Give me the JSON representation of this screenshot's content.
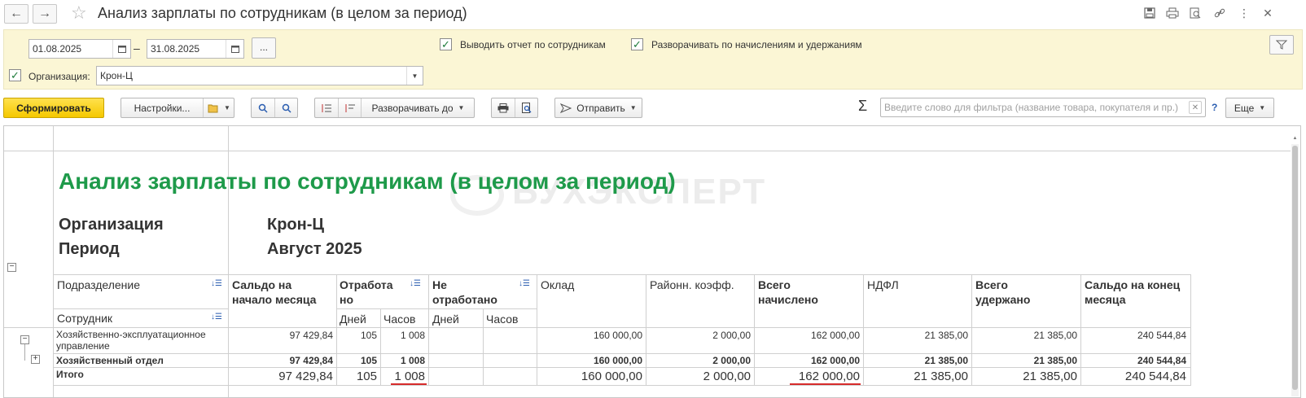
{
  "window": {
    "title": "Анализ зарплаты по сотрудникам (в целом за период)",
    "back_icon": "←",
    "forward_icon": "→",
    "star_icon": "☆",
    "more_icon": "⋮",
    "close_icon": "✕"
  },
  "params": {
    "date_from": "01.08.2025",
    "date_to": "31.08.2025",
    "date_dash": "–",
    "dots_label": "...",
    "show_by_employees_label": "Выводить отчет по сотрудникам",
    "expand_label": "Разворачивать по начислениям и удержаниям",
    "org_label": "Организация:",
    "org_value": "Крон-Ц",
    "check_mark": "✓"
  },
  "toolbar": {
    "generate_label": "Сформировать",
    "settings_label": "Настройки...",
    "expand_to_label": "Разворачивать до",
    "send_label": "Отправить",
    "sigma": "Σ",
    "search_placeholder": "Введите слово для фильтра (название товара, покупателя и пр.)",
    "help_label": "?",
    "more_label": "Еще"
  },
  "report": {
    "title": "Анализ зарплаты по сотрудникам (в целом за период)",
    "watermark": "БУХЭКСПЕРТ",
    "org_label": "Организация",
    "org_value": "Крон-Ц",
    "period_label": "Период",
    "period_value": "Август 2025",
    "headers": {
      "department": "Подразделение",
      "employee": "Сотрудник",
      "balance_start": "Сальдо на начало месяца",
      "worked": "Отработа но",
      "not_worked": "Не отработано",
      "days": "Дней",
      "hours": "Часов",
      "days2": "Дней",
      "hours2": "Часов",
      "salary": "Оклад",
      "regional_coef": "Районн. коэфф.",
      "total_accrued": "Всего начислено",
      "ndfl": "НДФЛ",
      "total_withheld": "Всего удержано",
      "balance_end": "Сальдо на конец месяца"
    },
    "rows": [
      {
        "name": "Хозяйственно-эксплуатационное управление",
        "balance_start": "97 429,84",
        "days": "105",
        "hours": "1 008",
        "days2": "",
        "hours2": "",
        "salary": "160 000,00",
        "regional_coef": "2 000,00",
        "total_accrued": "162 000,00",
        "ndfl": "21 385,00",
        "total_withheld": "21 385,00",
        "balance_end": "240 544,84"
      },
      {
        "name": "Хозяйственный отдел",
        "balance_start": "97 429,84",
        "days": "105",
        "hours": "1 008",
        "days2": "",
        "hours2": "",
        "salary": "160 000,00",
        "regional_coef": "2 000,00",
        "total_accrued": "162 000,00",
        "ndfl": "21 385,00",
        "total_withheld": "21 385,00",
        "balance_end": "240 544,84"
      }
    ],
    "total": {
      "name": "Итого",
      "balance_start": "97 429,84",
      "days": "105",
      "hours": "1 008",
      "salary": "160 000,00",
      "regional_coef": "2 000,00",
      "total_accrued": "162 000,00",
      "ndfl": "21 385,00",
      "total_withheld": "21 385,00",
      "balance_end": "240 544,84"
    }
  }
}
